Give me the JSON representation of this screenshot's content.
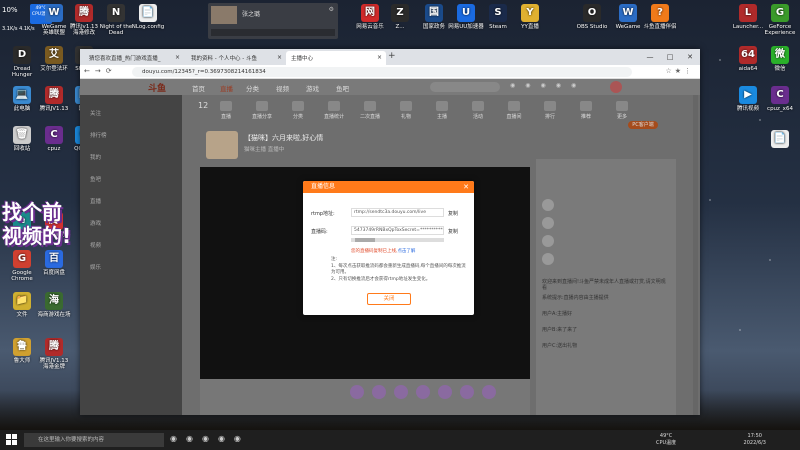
{
  "desktop": {
    "sys_percent": "10%",
    "cpu_temp": "49°C",
    "cpu_label": "CPU温度",
    "sys_numbers": "3.1K/s  4.1K/s",
    "left_icons": [
      {
        "label": "WeGame",
        "sub": "英雄联盟",
        "color": "#2b6cc4",
        "glyph": "W"
      },
      {
        "label": "腾讯Jv1.13",
        "sub": "海港修改",
        "color": "#b02a2a",
        "glyph": "腾"
      },
      {
        "label": "Night of the",
        "sub": "Dead",
        "color": "#333",
        "glyph": "N"
      },
      {
        "label": "NLog.config",
        "sub": "",
        "color": "#eee",
        "glyph": "📄"
      },
      {
        "label": "Dread",
        "sub": "Hunger",
        "color": "#2a2a2a",
        "glyph": "D"
      },
      {
        "label": "艾尔登法环",
        "sub": "",
        "color": "#7a5a20",
        "glyph": "艾"
      },
      {
        "label": "ShadX",
        "sub": "",
        "color": "#333",
        "glyph": "S"
      },
      {
        "label": "此电脑",
        "sub": "",
        "color": "#3a8ad0",
        "glyph": "💻"
      },
      {
        "label": "腾讯JV1.13",
        "sub": "",
        "color": "#b02a2a",
        "glyph": "腾"
      },
      {
        "label": "网络",
        "sub": "",
        "color": "#3a8ad0",
        "glyph": "网"
      },
      {
        "label": "回收站",
        "sub": "",
        "color": "#ccc",
        "glyph": "🗑"
      },
      {
        "label": "cpuz",
        "sub": "",
        "color": "#6a2d8e",
        "glyph": "C"
      },
      {
        "label": "QQ游戏",
        "sub": "",
        "color": "#1a8ae0",
        "glyph": "Q"
      },
      {
        "label": "Microsoft",
        "sub": "Edge",
        "color": "#1a8a8a",
        "glyph": "e"
      },
      {
        "label": "腾讯多媒助手",
        "sub": "",
        "color": "#d03030",
        "glyph": "腾"
      },
      {
        "label": "Google",
        "sub": "Chrome",
        "color": "#d04030",
        "glyph": "G"
      },
      {
        "label": "百度网盘",
        "sub": "",
        "color": "#2a6ae0",
        "glyph": "百"
      },
      {
        "label": "文件",
        "sub": "",
        "color": "#d0b030",
        "glyph": "📁"
      },
      {
        "label": "海商游戏在场",
        "sub": "",
        "color": "#3a6a30",
        "glyph": "海"
      },
      {
        "label": "鲁大师",
        "sub": "",
        "color": "#d0a030",
        "glyph": "鲁"
      },
      {
        "label": "腾讯JV1.13",
        "sub": "海港金牌",
        "color": "#b02a2a",
        "glyph": "腾"
      }
    ],
    "overlay_text": "找个前视频的!",
    "right_icons": [
      {
        "label": "网易云音乐",
        "color": "#d02a2a",
        "glyph": "网"
      },
      {
        "label": "Z...",
        "color": "#2a2a2a",
        "glyph": "Z"
      },
      {
        "label": "国家政务",
        "color": "#1a4a8a",
        "glyph": "国"
      },
      {
        "label": "网易UU加速器",
        "color": "#1a6ae0",
        "glyph": "U"
      },
      {
        "label": "Steam",
        "color": "#1a2a4a",
        "glyph": "S"
      },
      {
        "label": "YY直播",
        "color": "#e0b030",
        "glyph": "Y"
      },
      {
        "label": "OBS Studio",
        "color": "#2a2a2a",
        "glyph": "O"
      },
      {
        "label": "WeGame",
        "color": "#2b6cc4",
        "glyph": "W"
      },
      {
        "label": "斗鱼直播伴侣",
        "color": "#f07a1a",
        "glyph": "?"
      },
      {
        "label": "Launcher...",
        "color": "#b02a2a",
        "glyph": "L"
      },
      {
        "label": "GeForce Experience",
        "color": "#3a9a2a",
        "glyph": "G"
      },
      {
        "label": "aida64",
        "color": "#b02a2a",
        "glyph": "64"
      },
      {
        "label": "微信",
        "color": "#2ab02a",
        "glyph": "微"
      },
      {
        "label": "腾讯视频",
        "color": "#1a8ae0",
        "glyph": "▶"
      },
      {
        "label": "cpuz_x64",
        "color": "#6a2d8e",
        "glyph": "C"
      },
      {
        "label": "",
        "color": "#eee",
        "glyph": "📄"
      }
    ]
  },
  "media": {
    "title": "张之璐"
  },
  "browser": {
    "tabs": [
      {
        "label": "猜您喜欢直播_热门游戏直播_",
        "active": false
      },
      {
        "label": "我的资料 - 个人中心 - 斗鱼",
        "active": false
      },
      {
        "label": "主播中心",
        "active": true
      }
    ],
    "url": "douyu.com/12345?_r=0.3697308214161834",
    "window_controls": [
      "—",
      "□",
      "✕"
    ]
  },
  "site": {
    "logo": "斗鱼",
    "nav": [
      {
        "label": "首页",
        "active": false
      },
      {
        "label": "直播",
        "active": true
      },
      {
        "label": "分类",
        "active": false
      },
      {
        "label": "视频",
        "active": false
      },
      {
        "label": "游戏",
        "active": false
      },
      {
        "label": "鱼吧",
        "active": false
      }
    ],
    "pc_client": "PC客户端",
    "sidebar": [
      "关注",
      "排行榜",
      "我的",
      "鱼吧",
      "直播",
      "游戏",
      "视频",
      "娱乐"
    ],
    "categories": [
      "直播",
      "直播分享",
      "分类",
      "直播统计",
      "二次直播",
      "礼物",
      "主播",
      "活动",
      "直播间",
      "排行",
      "推荐",
      "更多"
    ],
    "count": "12",
    "stream_title": "【猫咪】六月来啦,好心情",
    "stream_sub": "猫咪主播 直播中",
    "chat_lines": [
      "欢迎来到直播间!斗鱼严禁未成年人直播或打赏,请文明观看",
      "系统提示:直播内容由主播提供",
      "用户A:主播好",
      "用户B:来了来了",
      "用户C:送出礼物"
    ]
  },
  "dialog": {
    "title": "直播信息",
    "rtmp_label": "rtmp地址:",
    "rtmp_value": "rtmp://sendtc3a.douyu.com/live",
    "code_label": "直播码:",
    "code_value": "5473749rRNBxQpToxSecret=************",
    "copy": "复制",
    "warning": "您的直播码复制已上线,",
    "warning_link": "点击了解",
    "note_title": "注:",
    "note1": "1、每次点击获取推流码都会重新生成直播码,每个直播间的每次推流为可用。",
    "note2": "2、只有切换推流后才会获得rtmp地址发生变化。",
    "ok": "关闭"
  },
  "taskbar": {
    "search": "在这里输入你要搜索的内容",
    "temp": "49°C",
    "temp_label": "CPU温度",
    "time": "17:50",
    "date": "2022/6/3"
  }
}
